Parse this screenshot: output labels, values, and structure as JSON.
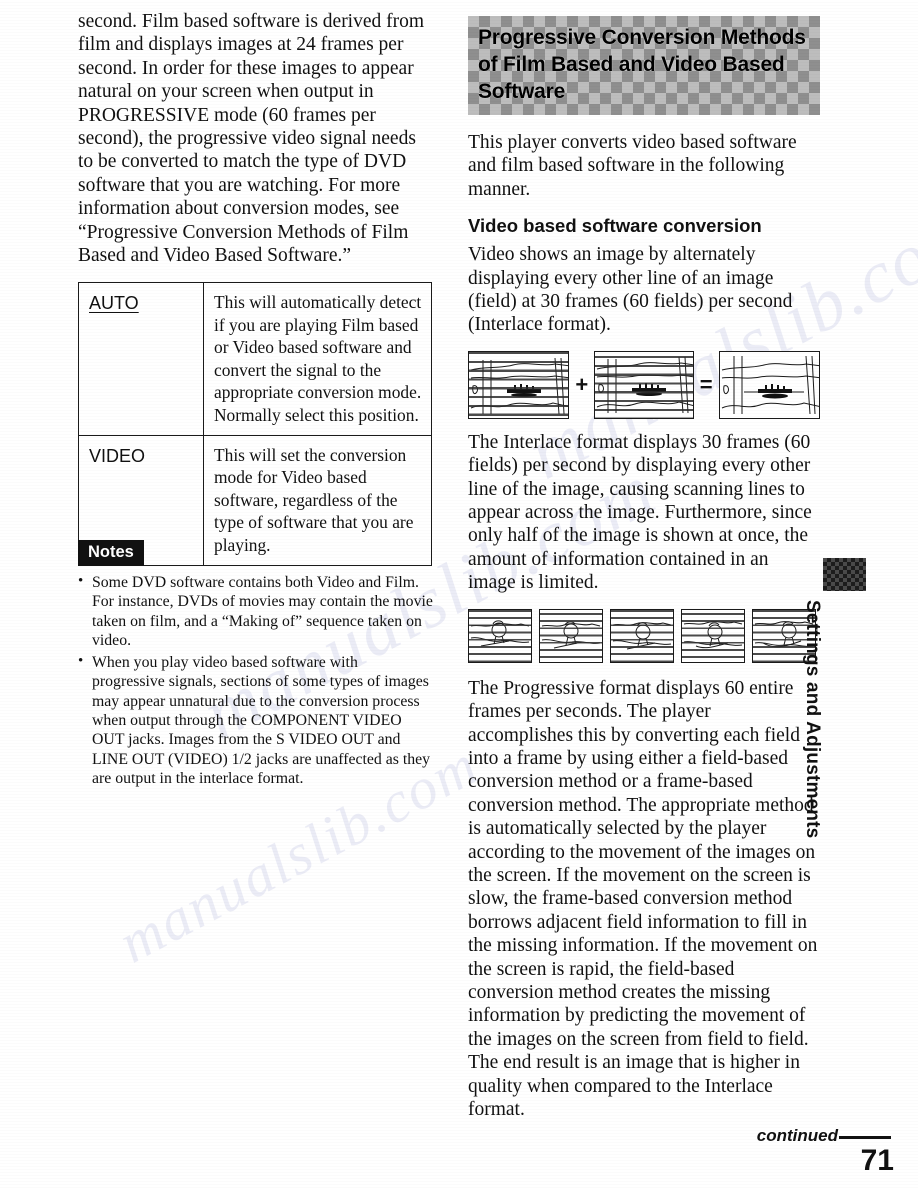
{
  "left_column": {
    "intro_paragraph": "second. Film based software is derived from film and displays images at 24 frames per second. In order for these images to appear natural on your screen when output in PROGRESSIVE mode (60 frames per second), the progressive video signal needs to be converted to match the type of DVD software that you are watching. For more information about conversion modes, see “Progressive Conversion Methods of Film Based and Video Based Software.”",
    "option_table": {
      "rows": [
        {
          "key": "AUTO",
          "key_underlined": true,
          "description": "This will automatically detect if you are playing Film based or Video based software and convert the signal to the appropriate conversion mode. Normally select this position."
        },
        {
          "key": "VIDEO",
          "key_underlined": false,
          "description": "This will set the conversion mode for Video based software, regardless of the type of software that you are playing."
        }
      ]
    },
    "notes": {
      "badge_label": "Notes",
      "items": [
        "Some DVD software contains both Video and Film. For instance, DVDs of movies may contain the movie taken on film, and a “Making of” sequence taken on video.",
        "When you play video based software with progressive signals, sections of some types of images may appear unnatural due to the conversion process when output through the COMPONENT VIDEO OUT jacks. Images from the S VIDEO OUT and LINE OUT (VIDEO) 1/2 jacks are unaffected as they are output in the interlace format."
      ]
    }
  },
  "right_column": {
    "section_heading": "Progressive Conversion Methods of Film Based and Video Based Software",
    "lead_paragraph": "This player converts video based software and film based software in the following manner.",
    "sub_heading": "Video based software conversion",
    "paragraph_1": "Video shows an image by alternately displaying every other line of an image (field) at 30 frames (60 fields) per second (Interlace format).",
    "figure_interlace": {
      "operator_plus": "+",
      "operator_equals": "=",
      "panel_labels": [
        "field-1-boat-scene",
        "field-2-boat-scene",
        "combined-frame-boat-scene"
      ]
    },
    "paragraph_2": "The Interlace format displays 30 frames (60 fields) per second by displaying every other line of the image, causing scanning lines to appear across the image. Furthermore, since only half of the image is shown at once, the amount of information contained in an image is limited.",
    "figure_frames": {
      "frame_count": 5,
      "frame_labels": [
        "frame-1-skier",
        "frame-2-skier",
        "frame-3-skier",
        "frame-4-skier",
        "frame-5-skier"
      ]
    },
    "paragraph_3": "The Progressive format displays 60 entire frames per seconds. The player accomplishes this by converting each field into a frame by using either a field-based conversion method or a frame-based conversion method. The appropriate method is automatically selected by the player according to the movement of the images on the screen. If the movement on the screen is slow, the frame-based conversion method borrows adjacent field information to fill in the missing information. If the movement on the screen is rapid, the field-based conversion method creates the missing information by predicting the movement of the images on the screen from field to field. The end result is an image that is higher in quality when compared to the Interlace format."
  },
  "side_tab": {
    "label": "Settings and Adjustments"
  },
  "footer": {
    "continued_label": "continued",
    "page_number": "71"
  },
  "watermark": {
    "text": "manualslib.com"
  },
  "colors": {
    "text": "#111111",
    "rule": "#1a1a1a",
    "notes_badge_bg": "#111111",
    "notes_badge_fg": "#ffffff",
    "header_band_gray": "#bdbdbd",
    "header_band_dark": "#8f8f8f",
    "watermark_blue": "#5560b0"
  }
}
